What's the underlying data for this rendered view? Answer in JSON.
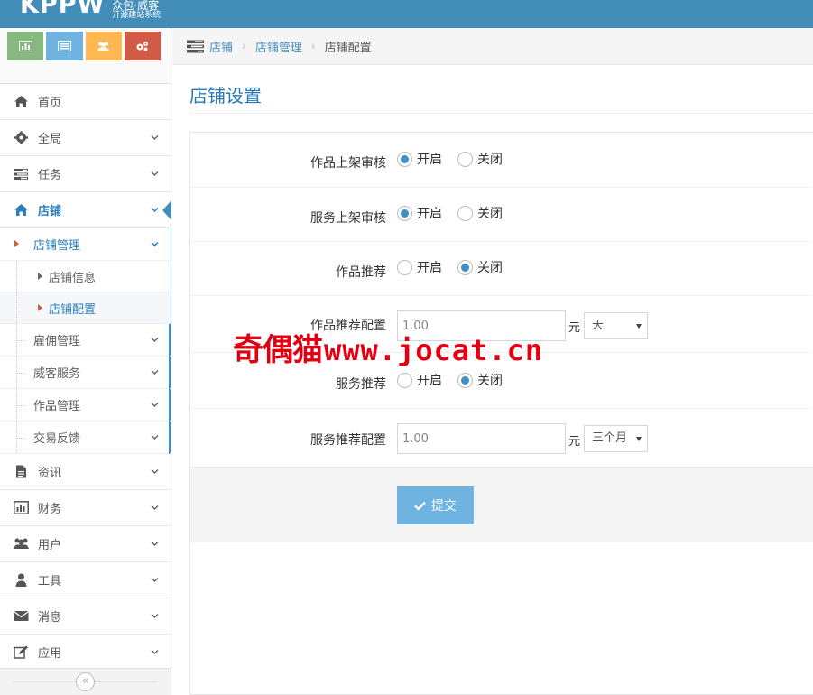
{
  "brand": {
    "logo": "KPPW",
    "name": "众包·威客",
    "tagline": "开源建站系统"
  },
  "shortcuts": [
    {
      "name": "chart-icon",
      "color": "#87b87f"
    },
    {
      "name": "list-icon",
      "color": "#6fb3e0"
    },
    {
      "name": "users-icon",
      "color": "#ffb752"
    },
    {
      "name": "cogs-icon",
      "color": "#d15b47"
    }
  ],
  "sidebar": {
    "home": "首页",
    "global": "全局",
    "task": "任务",
    "shop": "店铺",
    "shop_children": {
      "shop_manage": "店铺管理",
      "shop_info": "店铺信息",
      "shop_config": "店铺配置",
      "hire_manage": "雇佣管理",
      "witkey_service": "威客服务",
      "works_manage": "作品管理",
      "trade_feedback": "交易反馈"
    },
    "news": "资讯",
    "finance": "财务",
    "user": "用户",
    "tools": "工具",
    "message": "消息",
    "apps": "应用",
    "collapse_symbol": "«"
  },
  "breadcrumb": {
    "root": "店铺",
    "parent": "店铺管理",
    "current": "店铺配置",
    "sep": "›"
  },
  "page": {
    "title": "店铺设置"
  },
  "form": {
    "opt_on": "开启",
    "opt_off": "关闭",
    "works_audit": {
      "label": "作品上架审核",
      "value": "on"
    },
    "service_audit": {
      "label": "服务上架审核",
      "value": "on"
    },
    "works_recommend": {
      "label": "作品推荐",
      "value": "off"
    },
    "works_recommend_config": {
      "label": "作品推荐配置",
      "price": "1.00",
      "unit": "元",
      "period": "天"
    },
    "service_recommend": {
      "label": "服务推荐",
      "value": "off"
    },
    "service_recommend_config": {
      "label": "服务推荐配置",
      "price": "1.00",
      "unit": "元",
      "period": "三个月"
    },
    "submit_label": "提交"
  },
  "watermark": {
    "cn": "奇偶猫",
    "url": "www.jocat.cn"
  },
  "colors": {
    "topbar": "#438eb9",
    "link": "#2b7dbc",
    "primary_button": "#6fb3e0",
    "watermark": "#e00011"
  }
}
